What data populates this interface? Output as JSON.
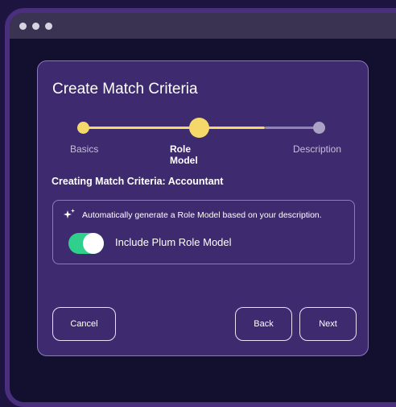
{
  "window": {
    "controls": [
      "window-dot",
      "window-dot",
      "window-dot"
    ]
  },
  "card": {
    "title": "Create Match Criteria"
  },
  "stepper": {
    "steps": [
      {
        "label": "Basics",
        "state": "complete"
      },
      {
        "label": "Role Model",
        "state": "current"
      },
      {
        "label": "Description",
        "state": "pending"
      }
    ]
  },
  "subheading": "Creating Match Criteria: Accountant",
  "panel": {
    "icon": "sparkle-icon",
    "description": "Automatically generate a Role Model based on your description.",
    "toggle": {
      "label": "Include Plum Role Model",
      "on": true
    }
  },
  "buttons": {
    "cancel": "Cancel",
    "back": "Back",
    "next": "Next"
  },
  "colors": {
    "accent_yellow": "#f5d86a",
    "toggle_green": "#2fd08c",
    "card_bg": "#3e2a6e",
    "window_frame": "#4a2f7e"
  }
}
